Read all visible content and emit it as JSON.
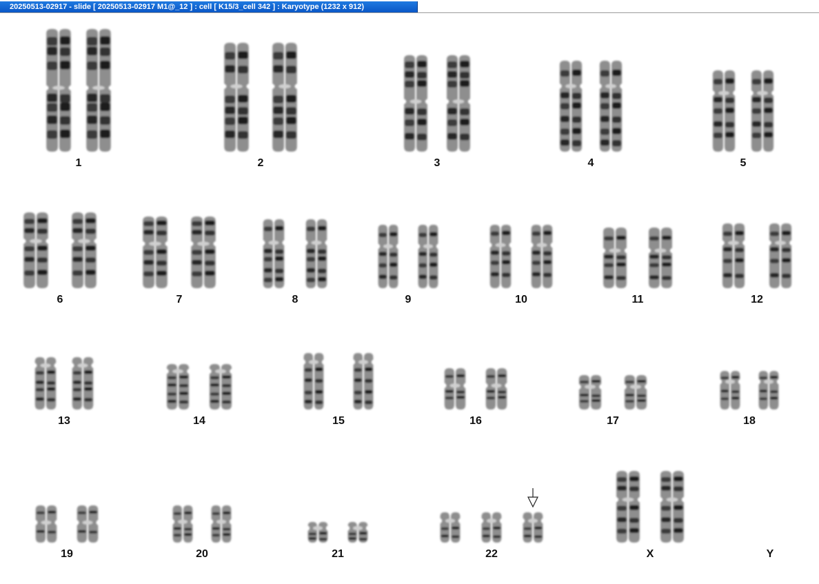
{
  "window": {
    "title": "20250513-02917 - slide [ 20250513-02917 M1@_12 ] : cell [ K15/3_cell 342 ] : Karyotype  (1232 x 912)"
  },
  "karyotype": {
    "chromosomes": [
      {
        "label": "1",
        "count": 2
      },
      {
        "label": "2",
        "count": 2
      },
      {
        "label": "3",
        "count": 2
      },
      {
        "label": "4",
        "count": 2
      },
      {
        "label": "5",
        "count": 2
      },
      {
        "label": "6",
        "count": 2
      },
      {
        "label": "7",
        "count": 2
      },
      {
        "label": "8",
        "count": 2
      },
      {
        "label": "9",
        "count": 2
      },
      {
        "label": "10",
        "count": 2
      },
      {
        "label": "11",
        "count": 2
      },
      {
        "label": "12",
        "count": 2
      },
      {
        "label": "13",
        "count": 2
      },
      {
        "label": "14",
        "count": 2
      },
      {
        "label": "15",
        "count": 2
      },
      {
        "label": "16",
        "count": 2
      },
      {
        "label": "17",
        "count": 2
      },
      {
        "label": "18",
        "count": 2
      },
      {
        "label": "19",
        "count": 2
      },
      {
        "label": "20",
        "count": 2
      },
      {
        "label": "21",
        "count": 2
      },
      {
        "label": "22",
        "count": 3,
        "marked": true
      },
      {
        "label": "X",
        "count": 2
      },
      {
        "label": "Y",
        "count": 0
      }
    ],
    "marker_icon": "down-arrow-icon"
  }
}
